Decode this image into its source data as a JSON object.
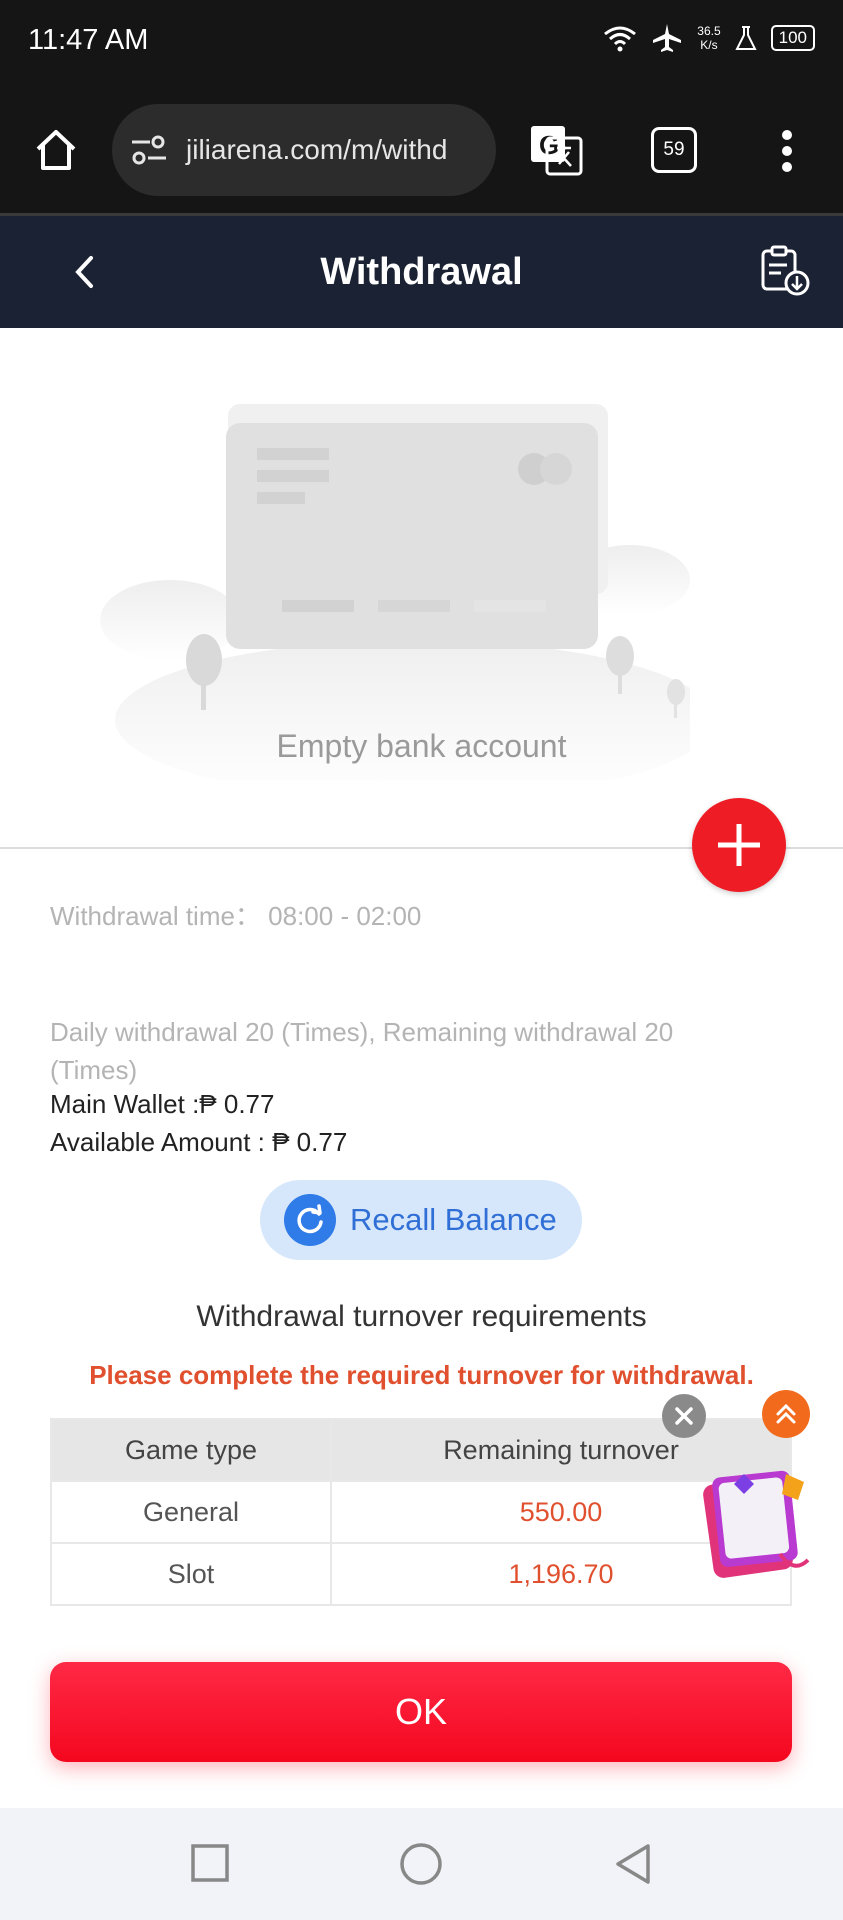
{
  "status_bar": {
    "time": "11:47 AM",
    "speed_value": "36.5",
    "speed_unit": "K/s",
    "battery": "100"
  },
  "browser": {
    "url": "jiliarena.com/m/withd",
    "tab_count": "59"
  },
  "header": {
    "title": "Withdrawal"
  },
  "bank": {
    "empty_text": "Empty bank account"
  },
  "info": {
    "withdrawal_time": "Withdrawal time：  08:00 - 02:00",
    "daily_limit": "Daily withdrawal 20 (Times), Remaining withdrawal 20 (Times)",
    "main_wallet": "Main Wallet :₱ 0.77",
    "available_amount": "Available Amount : ₱ 0.77"
  },
  "recall": {
    "label": "Recall Balance"
  },
  "turnover": {
    "title": "Withdrawal turnover requirements",
    "warning": "Please complete the required turnover for withdrawal.",
    "columns": [
      "Game type",
      "Remaining turnover"
    ],
    "rows": [
      {
        "game_type": "General",
        "remaining": "550.00"
      },
      {
        "game_type": "Slot",
        "remaining": "1,196.70"
      }
    ]
  },
  "actions": {
    "ok_label": "OK"
  },
  "colors": {
    "header_bg": "#1a2233",
    "accent_red": "#ee1c24",
    "ok_red": "#f4071f",
    "warning": "#e0502e",
    "recall_blue": "#2f6fd6"
  },
  "icons": [
    "home-icon",
    "site-settings-icon",
    "translate-icon",
    "tabs-icon",
    "more-icon",
    "back-icon",
    "records-icon",
    "plus-icon",
    "refresh-icon",
    "close-icon",
    "scroll-top-icon",
    "gift-icon",
    "nav-recents-icon",
    "nav-home-icon",
    "nav-back-icon"
  ]
}
